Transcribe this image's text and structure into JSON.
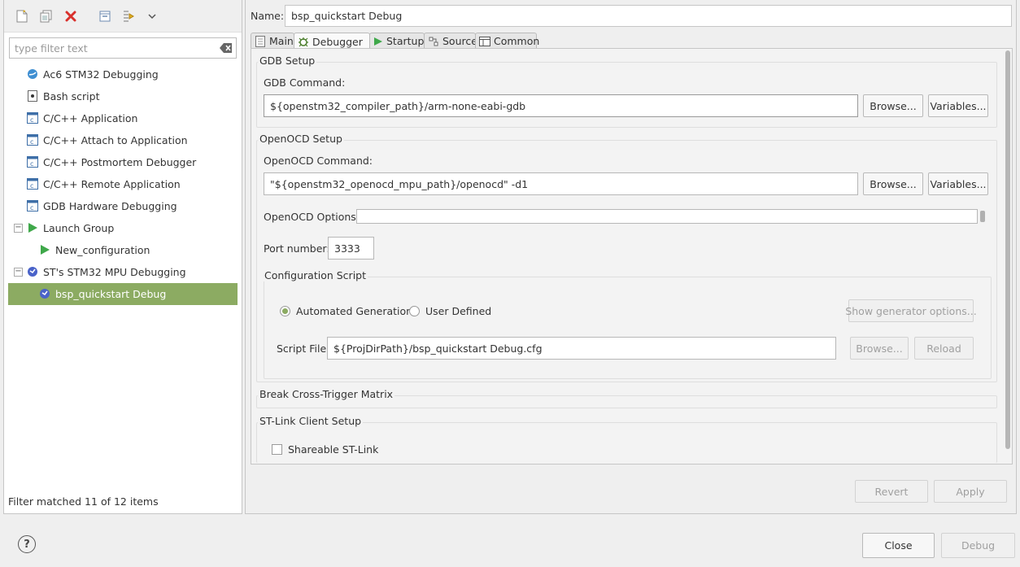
{
  "left_panel": {
    "filter": {
      "placeholder": "type filter text",
      "value": ""
    },
    "tree": [
      {
        "label": "Ac6 STM32 Debugging",
        "icon": "stm32-debug-icon",
        "level": 0
      },
      {
        "label": "Bash script",
        "icon": "bash-script-icon",
        "level": 0
      },
      {
        "label": "C/C++ Application",
        "icon": "c-app-icon",
        "level": 0
      },
      {
        "label": "C/C++ Attach to Application",
        "icon": "c-app-icon",
        "level": 0
      },
      {
        "label": "C/C++ Postmortem Debugger",
        "icon": "c-app-icon",
        "level": 0
      },
      {
        "label": "C/C++ Remote Application",
        "icon": "c-app-icon",
        "level": 0
      },
      {
        "label": "GDB Hardware Debugging",
        "icon": "c-app-icon",
        "level": 0
      },
      {
        "label": "Launch Group",
        "icon": "launch-group-icon",
        "level": 0,
        "expander": "−"
      },
      {
        "label": "New_configuration",
        "icon": "launch-group-icon",
        "level": 1
      },
      {
        "label": "ST's STM32 MPU Debugging",
        "icon": "stm32-mpu-icon",
        "level": 0,
        "expander": "−"
      },
      {
        "label": "bsp_quickstart Debug",
        "icon": "stm32-mpu-icon",
        "level": 1,
        "selected": true
      }
    ],
    "status": "Filter matched 11 of 12 items"
  },
  "right_panel": {
    "name_label": "Name:",
    "name_value": "bsp_quickstart Debug",
    "tabs": [
      {
        "label": "Main",
        "icon": "main-tab-icon"
      },
      {
        "label": "Debugger",
        "icon": "debugger-tab-icon",
        "active": true
      },
      {
        "label": "Startup",
        "icon": "startup-tab-icon"
      },
      {
        "label": "Source",
        "icon": "source-tab-icon"
      },
      {
        "label": "Common",
        "icon": "common-tab-icon"
      }
    ],
    "gdb": {
      "title": "GDB Setup",
      "command_label": "GDB Command:",
      "command_value": "${openstm32_compiler_path}/arm-none-eabi-gdb",
      "browse": "Browse...",
      "variables": "Variables..."
    },
    "openocd": {
      "title": "OpenOCD Setup",
      "command_label": "OpenOCD Command:",
      "command_value": "\"${openstm32_openocd_mpu_path}/openocd\" -d1",
      "browse": "Browse...",
      "variables": "Variables...",
      "options_label": "OpenOCD Options :",
      "options_value": "",
      "port_label": "Port number:",
      "port_value": "3333"
    },
    "config_script": {
      "title": "Configuration Script",
      "automated": "Automated Generation",
      "user_defined": "User Defined",
      "selected": "automated",
      "show_generator": "Show generator options...",
      "script_label": "Script File:",
      "script_value": "${ProjDirPath}/bsp_quickstart Debug.cfg",
      "browse": "Browse...",
      "reload": "Reload"
    },
    "break_matrix_title": "Break Cross-Trigger Matrix",
    "stlink": {
      "title": "ST-Link Client Setup",
      "shareable": "Shareable ST-Link",
      "checked": false
    },
    "revert": "Revert",
    "apply": "Apply"
  },
  "footer": {
    "help": "?",
    "close": "Close",
    "debug": "Debug"
  },
  "colors": {
    "selection": "#8cab62",
    "disabled_text": "#a0a0a0",
    "delete_red": "#d9302c"
  }
}
